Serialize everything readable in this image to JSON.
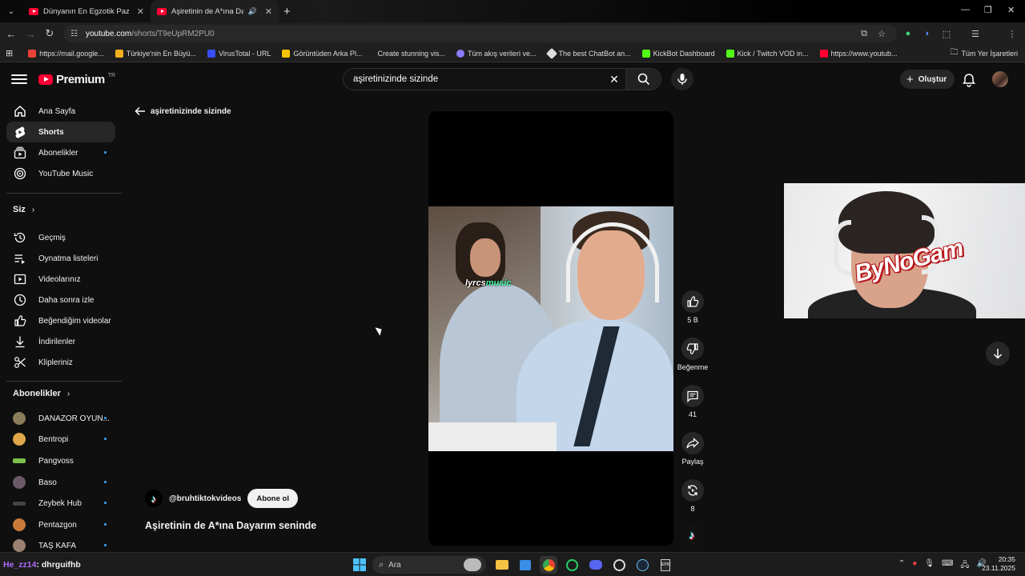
{
  "browser": {
    "tabs": [
      {
        "title": "Dünyanın En Egzotik Pazarı! Pe",
        "active": false
      },
      {
        "title": "Aşiretinin de A*ına Dayarım",
        "active": true
      }
    ],
    "url_host": "youtube.com",
    "url_path": "/shorts/T9eUpRM2PU0",
    "bookmarks": [
      {
        "label": "https://mail.google...",
        "color": "#ea4335"
      },
      {
        "label": "Türkiye'nin En Büyü...",
        "color": "#f2b01e"
      },
      {
        "label": "VirusTotal - URL",
        "color": "#394eff"
      },
      {
        "label": "Görüntüden Arka Pl...",
        "color": "#f5c400"
      },
      {
        "label": "Create stunning vis...",
        "color": "#ffffff"
      },
      {
        "label": "Tüm akış verileri ve...",
        "color": "#8a7cff"
      },
      {
        "label": "The best ChatBot an...",
        "color": "#dddddd"
      },
      {
        "label": "KickBot Dashboard",
        "color": "#53fc18"
      },
      {
        "label": "Kick / Twitch VOD in...",
        "color": "#53fc18"
      },
      {
        "label": "https://www.youtub...",
        "color": "#ff0033"
      }
    ],
    "all_bookmarks": "Tüm Yer İşaretleri"
  },
  "header": {
    "logo_word": "Premium",
    "country": "TR",
    "search_query": "aşiretinizinde sizinde",
    "create_label": "Oluştur"
  },
  "sidebar": {
    "main": [
      {
        "label": "Ana Sayfa",
        "icon": "home-icon"
      },
      {
        "label": "Shorts",
        "icon": "shorts-icon",
        "active": true
      },
      {
        "label": "Abonelikler",
        "icon": "subscriptions-icon",
        "dot": true
      },
      {
        "label": "YouTube Music",
        "icon": "music-icon"
      }
    ],
    "you_heading": "Siz",
    "you": [
      {
        "label": "Geçmiş",
        "icon": "history-icon"
      },
      {
        "label": "Oynatma listeleri",
        "icon": "playlists-icon"
      },
      {
        "label": "Videolarınız",
        "icon": "your-videos-icon"
      },
      {
        "label": "Daha sonra izle",
        "icon": "watch-later-icon"
      },
      {
        "label": "Beğendiğim videolar",
        "icon": "liked-icon"
      },
      {
        "label": "İndirilenler",
        "icon": "downloads-icon"
      },
      {
        "label": "Klipleriniz",
        "icon": "clips-icon"
      }
    ],
    "subs_heading": "Abonelikler",
    "subs": [
      {
        "label": "DANAZOR OYUN...",
        "color": "#8b7d5a",
        "dot": true
      },
      {
        "label": "Bentropi",
        "color": "#e0a84a",
        "dot": true
      },
      {
        "label": "Pangvoss",
        "color": "#7cc04a",
        "dot": false
      },
      {
        "label": "Baso",
        "color": "#6a5a66",
        "dot": true
      },
      {
        "label": "Zeybek Hub",
        "color": "#444444",
        "dot": true
      },
      {
        "label": "Pentazgon",
        "color": "#c97a3a",
        "dot": true
      },
      {
        "label": "TAŞ KAFA",
        "color": "#9a8070",
        "dot": true
      }
    ]
  },
  "short": {
    "back_label": "aşiretinizinde sizinde",
    "watermark_a": "lyrcs",
    "watermark_b": "music",
    "likes": "5 B",
    "dislike_label": "Beğenme",
    "comments": "41",
    "share_label": "Paylaş",
    "remix": "8",
    "channel_handle": "@bruhtiktokvideos",
    "subscribe_label": "Abone ol",
    "title": "Aşiretinin de A*ına Dayarım seninde"
  },
  "overlay": {
    "cam_tag": "ByNoGam"
  },
  "taskbar": {
    "chat_nick": "He_zz14",
    "chat_msg": ": dhrguifhb",
    "search_placeholder": "Ara",
    "time": "20:35",
    "date": "23.11.2025"
  }
}
